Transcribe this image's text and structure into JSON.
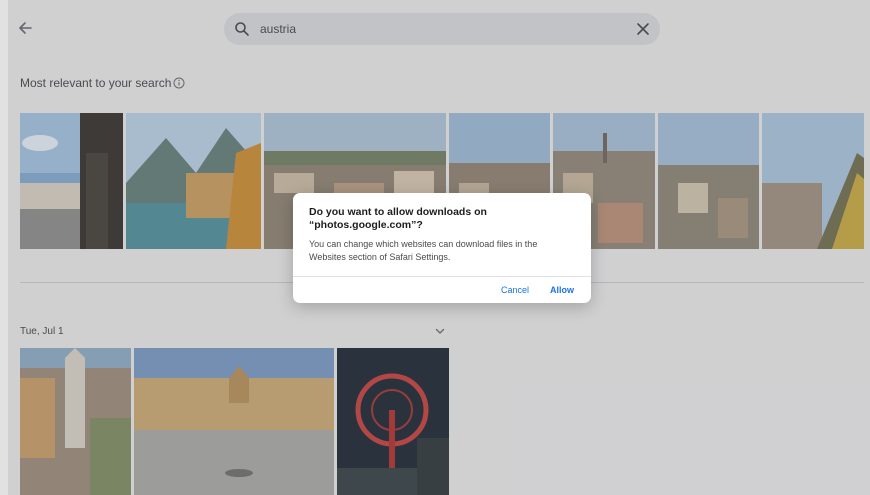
{
  "search": {
    "query": "austria"
  },
  "sections": {
    "relevant_title": "Most relevant to your search",
    "date_label": "Tue, Jul 1"
  },
  "dialog": {
    "title": "Do you want to allow downloads on “photos.google.com”?",
    "body": "You can change which websites can download files in the Websites section of Safari Settings.",
    "cancel_label": "Cancel",
    "allow_label": "Allow"
  },
  "colors": {
    "accent": "#1a73e8",
    "background": "#e9e9ea",
    "search_bg": "#d8d9db"
  },
  "icons": [
    "back-arrow-icon",
    "search-icon",
    "close-icon",
    "info-icon",
    "chevron-down-icon"
  ]
}
